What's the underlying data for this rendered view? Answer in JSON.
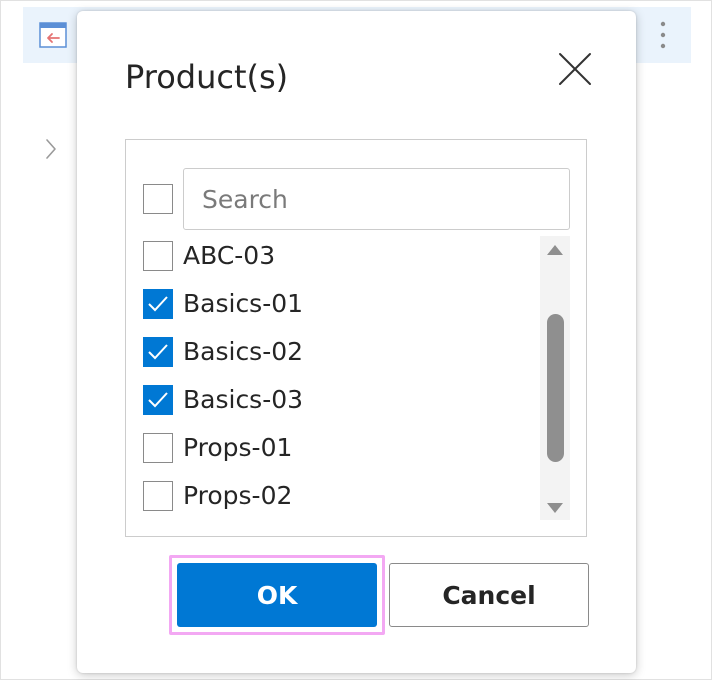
{
  "dialog": {
    "title": "Product(s)"
  },
  "search": {
    "placeholder": "Search",
    "value": ""
  },
  "options": [
    {
      "label": "ABC-03",
      "checked": false
    },
    {
      "label": "Basics-01",
      "checked": true
    },
    {
      "label": "Basics-02",
      "checked": true
    },
    {
      "label": "Basics-03",
      "checked": true
    },
    {
      "label": "Props-01",
      "checked": false
    },
    {
      "label": "Props-02",
      "checked": false
    }
  ],
  "select_all": {
    "checked": false
  },
  "buttons": {
    "ok_label": "OK",
    "cancel_label": "Cancel"
  },
  "colors": {
    "accent": "#0078d4",
    "focus_ring": "#f3a8f3",
    "header_background": "#eaf3fc"
  },
  "icons": {
    "close": "close-icon",
    "back": "panel-back-icon",
    "more": "more-vertical-icon",
    "expand": "chevron-right-icon",
    "check": "checkmark-icon"
  }
}
